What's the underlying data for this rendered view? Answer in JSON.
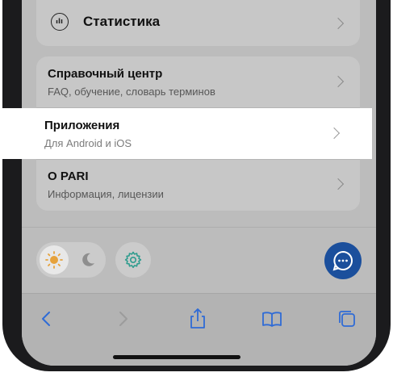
{
  "menu": {
    "statistics": {
      "label": "Статистика"
    },
    "help_center": {
      "title": "Справочный центр",
      "subtitle": "FAQ, обучение, словарь терминов"
    },
    "apps": {
      "title": "Приложения",
      "subtitle": "Для Android и iOS"
    },
    "about": {
      "title": "О PARI",
      "subtitle": "Информация, лицензии"
    }
  },
  "theme": {
    "light_icon": "sun-icon",
    "dark_icon": "moon-icon",
    "selected": "light",
    "sun_color": "#e6a23c"
  },
  "settings": {
    "icon": "gear-icon",
    "color": "#2f9c8e"
  },
  "support": {
    "icon": "chat-bubble-icon",
    "color": "#1b4f9c"
  },
  "browser_toolbar": {
    "items": [
      "back-icon",
      "forward-icon",
      "share-icon",
      "bookmarks-icon",
      "tabs-icon"
    ],
    "accent_color": "#2f6bd6"
  }
}
